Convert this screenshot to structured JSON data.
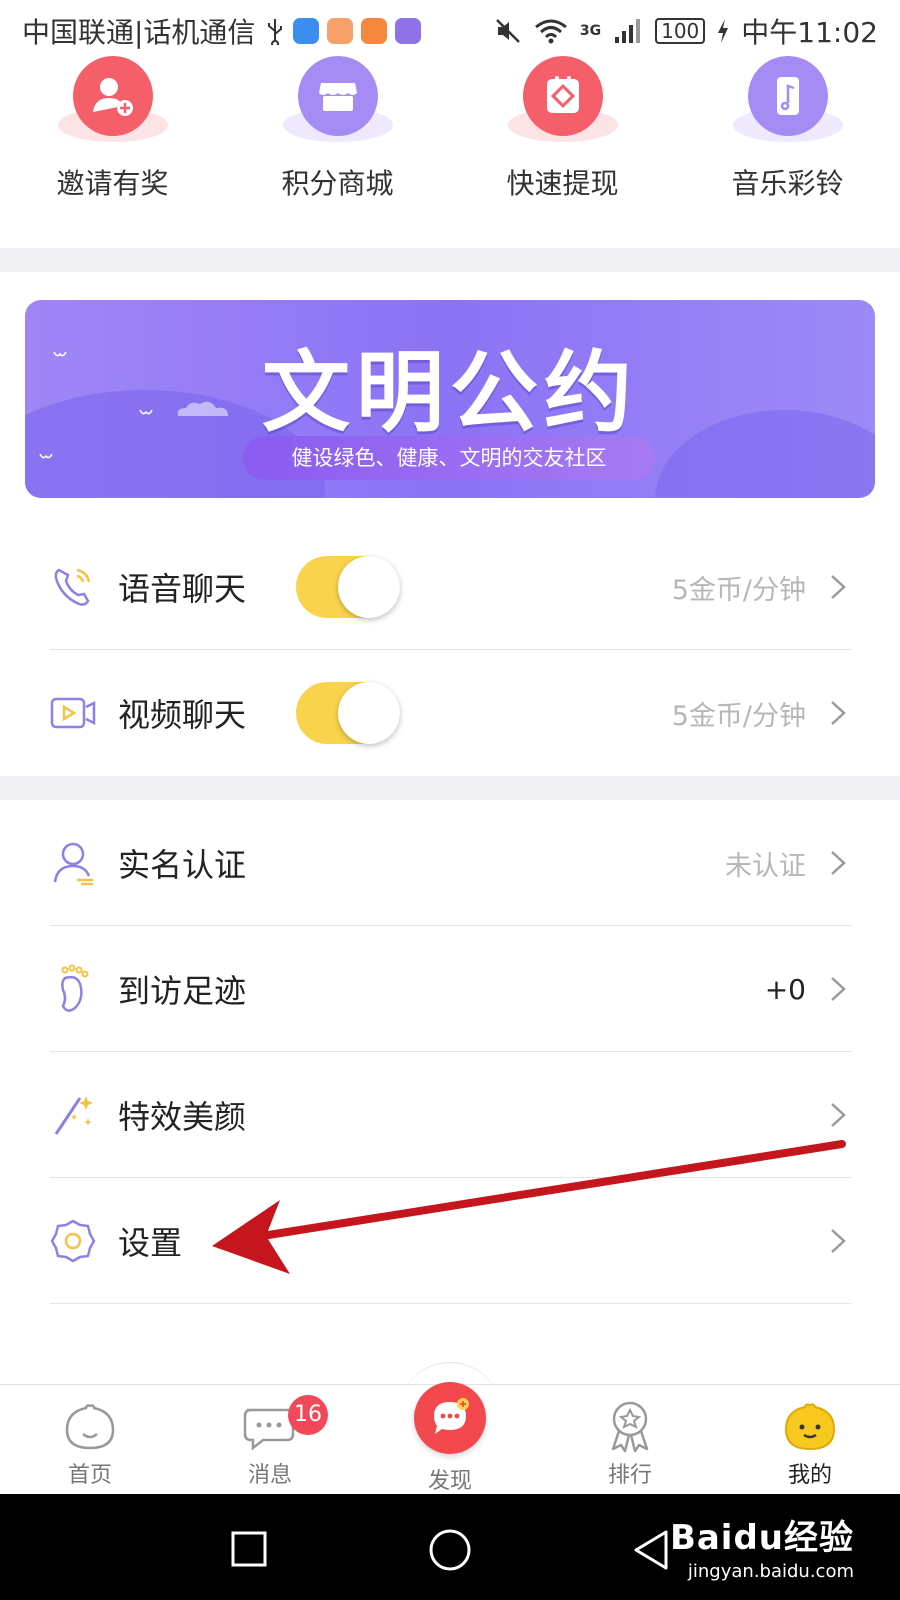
{
  "status_bar": {
    "carrier": "中国联通|话机通信",
    "time": "中午11:02",
    "battery": "100",
    "network": "3G"
  },
  "quick_actions": [
    {
      "label": "邀请有奖",
      "icon": "invite-user-icon",
      "color": "#f55f6a"
    },
    {
      "label": "积分商城",
      "icon": "store-icon",
      "color": "#a58cf4"
    },
    {
      "label": "快速提现",
      "icon": "withdraw-icon",
      "color": "#f55f6a"
    },
    {
      "label": "音乐彩铃",
      "icon": "music-phone-icon",
      "color": "#a58cf4"
    }
  ],
  "banner": {
    "title": "文明公约",
    "subtitle": "健设绿色、健康、文明的交友社区"
  },
  "chat_settings": [
    {
      "label": "语音聊天",
      "icon": "phone-call-icon",
      "enabled": true,
      "price": "5金币/分钟"
    },
    {
      "label": "视频聊天",
      "icon": "video-call-icon",
      "enabled": true,
      "price": "5金币/分钟"
    }
  ],
  "menu": [
    {
      "label": "实名认证",
      "icon": "user-verify-icon",
      "value": "未认证"
    },
    {
      "label": "到访足迹",
      "icon": "footprint-icon",
      "value": "+0"
    },
    {
      "label": "特效美颜",
      "icon": "magic-wand-icon",
      "value": ""
    },
    {
      "label": "设置",
      "icon": "gear-icon",
      "value": ""
    }
  ],
  "tabbar": {
    "items": [
      {
        "label": "首页",
        "icon": "home-face-icon"
      },
      {
        "label": "消息",
        "icon": "message-bubble-icon",
        "badge": "16"
      },
      {
        "label": "发现",
        "icon": "discover-chat-icon"
      },
      {
        "label": "排行",
        "icon": "ranking-ribbon-icon"
      },
      {
        "label": "我的",
        "icon": "profile-face-icon"
      }
    ],
    "active": "我的"
  },
  "watermark": {
    "main": "Baidu经验",
    "sub": "jingyan.baidu.com"
  },
  "colors": {
    "accent_yellow": "#f9d34b",
    "accent_purple": "#8c73f5",
    "accent_red": "#f3484d",
    "annotation_arrow": "#c4161c"
  }
}
